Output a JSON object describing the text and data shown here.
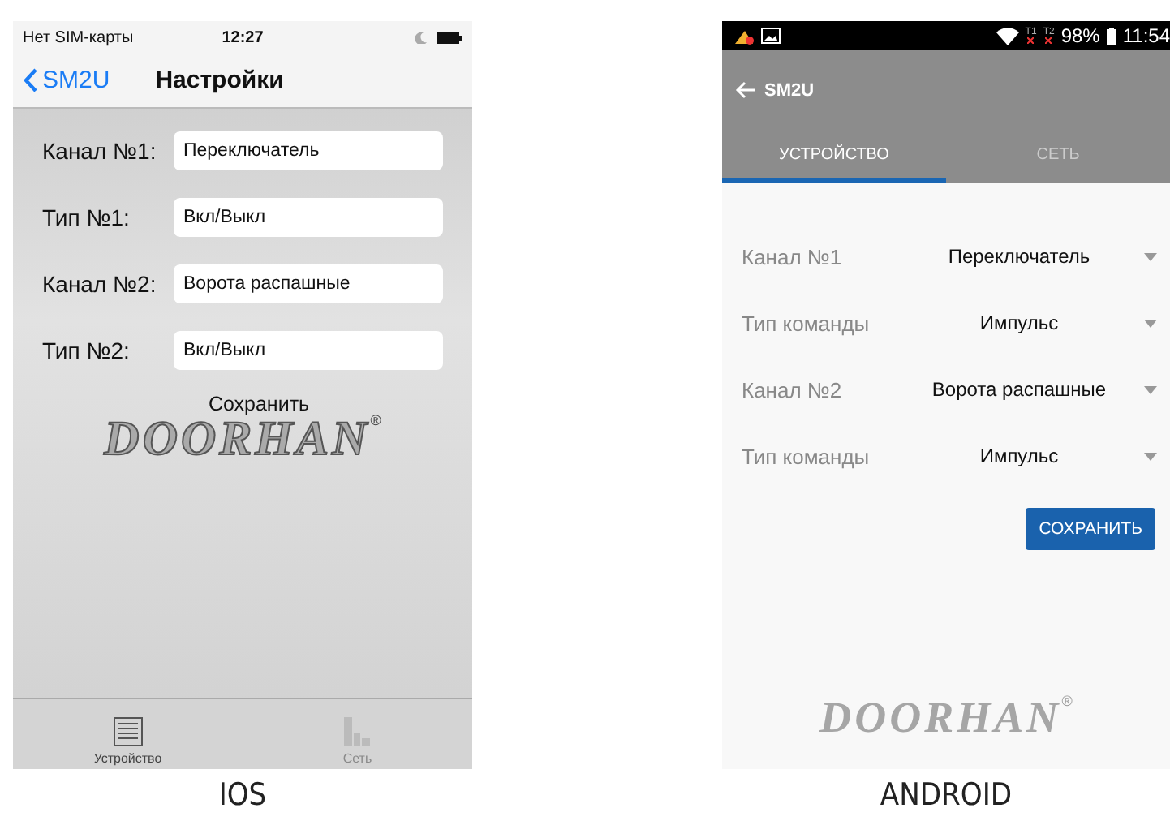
{
  "ios": {
    "caption": "IOS",
    "status_bar": {
      "carrier": "Нет SIM-карты",
      "time": "12:27"
    },
    "nav": {
      "back": "SM2U",
      "title": "Настройки"
    },
    "rows": [
      {
        "label": "Канал №1:",
        "value": "Переключатель"
      },
      {
        "label": "Тип №1:",
        "value": "Вкл/Выкл"
      },
      {
        "label": "Канал №2:",
        "value": "Ворота распашные"
      },
      {
        "label": "Тип №2:",
        "value": "Вкл/Выкл"
      }
    ],
    "save_button": "Сохранить",
    "logo": {
      "text": "DOORHAN",
      "mark": "®"
    },
    "tabs": [
      {
        "label": "Устройство",
        "kind": "device",
        "selected": true
      },
      {
        "label": "Сеть",
        "kind": "network",
        "selected": false
      }
    ]
  },
  "android": {
    "caption": "ANDROID",
    "status_bar": {
      "sims": [
        "T1",
        "T2"
      ],
      "battery": "98%",
      "time": "11:54"
    },
    "toolbar": {
      "back": "SM2U"
    },
    "tabs": [
      {
        "label": "УСТРОЙСТВО",
        "selected": true
      },
      {
        "label": "СЕТЬ",
        "selected": false
      }
    ],
    "rows": [
      {
        "label": "Канал №1",
        "value": "Переключатель"
      },
      {
        "label": "Тип команды",
        "value": "Импульс"
      },
      {
        "label": "Канал №2",
        "value": "Ворота распашные"
      },
      {
        "label": "Тип команды",
        "value": "Импульс"
      }
    ],
    "save_button": "СОХРАНИТЬ",
    "logo": {
      "text": "DOORHAN",
      "mark": "®"
    }
  }
}
